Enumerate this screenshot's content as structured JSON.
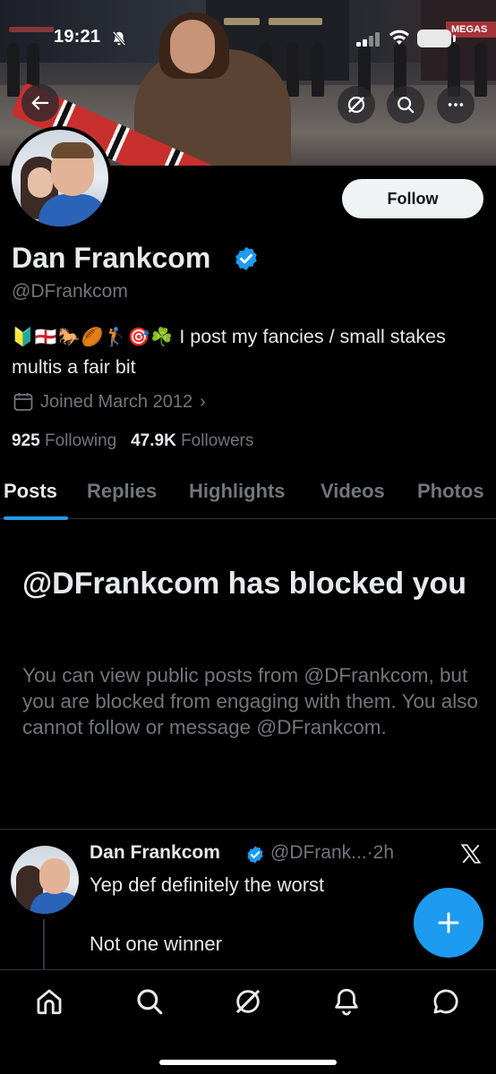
{
  "status_bar": {
    "time": "19:21",
    "icons": [
      "bell-off-icon",
      "signal-icon",
      "wifi-icon",
      "battery-icon"
    ]
  },
  "banner": {
    "sign_text": "MEGAS",
    "buttons": [
      "back-icon",
      "grok-icon",
      "search-icon",
      "more-icon"
    ]
  },
  "profile": {
    "follow_label": "Follow",
    "name": "Dan Frankcom",
    "verified": true,
    "handle": "@DFrankcom",
    "bio_emojis": "🔰🏴󠁧󠁢󠁥󠁮󠁧󠁿🐎🏉🏌️🎯☘️",
    "bio_text": "I post my fancies / small stakes multis a fair bit",
    "joined": "Joined March 2012",
    "following_count": "925",
    "following_label": "Following",
    "followers_count": "47.9K",
    "followers_label": "Followers"
  },
  "tabs": [
    {
      "label": "Posts",
      "active": true
    },
    {
      "label": "Replies",
      "active": false
    },
    {
      "label": "Highlights",
      "active": false
    },
    {
      "label": "Videos",
      "active": false
    },
    {
      "label": "Photos",
      "active": false
    }
  ],
  "blocked": {
    "title": "@DFrankcom has blocked you",
    "body": "You can view public posts from @DFrankcom, but you are blocked from engaging with them. You also cannot follow or message @DFrankcom."
  },
  "post": {
    "name": "Dan Frankcom",
    "handle_time": "@DFrank...·2h",
    "line1": "Yep def definitely the worst",
    "line2": "Not one winner"
  },
  "bottom_nav": [
    "home-icon",
    "search-icon",
    "grok-icon",
    "notifications-icon",
    "messages-icon"
  ],
  "colors": {
    "accent": "#1d9bf0",
    "background": "#000000",
    "text_primary": "#e7e9ea",
    "text_secondary": "#71767b"
  }
}
